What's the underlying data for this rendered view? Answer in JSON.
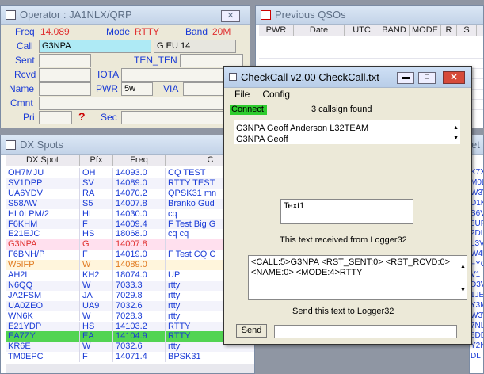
{
  "operator": {
    "title": "Operator : JA1NLX/QRP",
    "freq_label": "Freq",
    "freq_value": "14.089",
    "mode_label": "Mode",
    "mode_value": "RTTY",
    "band_label": "Band",
    "band_value": "20M",
    "call_label": "Call",
    "call_value": "G3NPA",
    "call_info": "G  EU  14",
    "sent_label": "Sent",
    "ten_label": "TEN_TEN",
    "rcvd_label": "Rcvd",
    "iota_label": "IOTA",
    "name_label": "Name",
    "pwr_label": "PWR",
    "pwr_value": "5w",
    "via_label": "VIA",
    "cmnt_label": "Cmnt",
    "pri_label": "Pri",
    "question": "?",
    "sec_label": "Sec"
  },
  "qsos": {
    "title": "Previous QSOs",
    "columns": [
      "PWR",
      "Date",
      "UTC",
      "BAND",
      "MODE",
      "R",
      "S"
    ]
  },
  "dx": {
    "title": "DX Spots",
    "columns": [
      "DX Spot",
      "Pfx",
      "Freq",
      "C"
    ],
    "rows": [
      {
        "call": "OH7MJU",
        "pfx": "OH",
        "freq": "14093.0",
        "comment": "CQ TEST"
      },
      {
        "call": "SV1DPP",
        "pfx": "SV",
        "freq": "14089.0",
        "comment": "RTTY TEST"
      },
      {
        "call": "UA6YDV",
        "pfx": "RA",
        "freq": "14070.2",
        "comment": "QPSK31 mn"
      },
      {
        "call": "S58AW",
        "pfx": "S5",
        "freq": "14007.8",
        "comment": "Branko Gud"
      },
      {
        "call": "HL0LPM/2",
        "pfx": "HL",
        "freq": "14030.0",
        "comment": "cq"
      },
      {
        "call": "F6KHM",
        "pfx": "F",
        "freq": "14009.4",
        "comment": "F Test Big G"
      },
      {
        "call": "E21EJC",
        "pfx": "HS",
        "freq": "18068.0",
        "comment": "cq cq"
      },
      {
        "call": "G3NPA",
        "pfx": "G",
        "freq": "14007.8",
        "comment": ""
      },
      {
        "call": "F6BNH/P",
        "pfx": "F",
        "freq": "14019.0",
        "comment": "F Test CQ C"
      },
      {
        "call": "W5IFP",
        "pfx": "W",
        "freq": "14089.0",
        "comment": ""
      },
      {
        "call": "AH2L",
        "pfx": "KH2",
        "freq": "18074.0",
        "comment": "UP"
      },
      {
        "call": "N6QQ",
        "pfx": "W",
        "freq": "7033.3",
        "comment": "rtty"
      },
      {
        "call": "JA2FSM",
        "pfx": "JA",
        "freq": "7029.8",
        "comment": "rtty"
      },
      {
        "call": "UA0ZEO",
        "pfx": "UA9",
        "freq": "7032.6",
        "comment": "rtty"
      },
      {
        "call": "WN6K",
        "pfx": "W",
        "freq": "7028.3",
        "comment": "rtty"
      },
      {
        "call": "E21YDP",
        "pfx": "HS",
        "freq": "14103.2",
        "comment": "RTTY"
      },
      {
        "call": "EA7ZY",
        "pfx": "EA",
        "freq": "14104.9",
        "comment": "RTTY"
      },
      {
        "call": "KR6E",
        "pfx": "W",
        "freq": "7032.6",
        "comment": "rtty"
      },
      {
        "call": "TM0EPC",
        "pfx": "F",
        "freq": "14071.4",
        "comment": "BPSK31"
      }
    ]
  },
  "right_edge": {
    "et": "et",
    "codes": [
      "K7X",
      "M0L",
      "W3V",
      "D1K",
      "S6V",
      "3UF",
      "2DL",
      "L3V",
      "W4L",
      "FYC",
      "V1",
      "D3V",
      "1JE",
      "Y3M",
      "W3V",
      "7NL",
      "6DD",
      "Y2N",
      "DL"
    ]
  },
  "checkcall": {
    "title": "CheckCall v2.00  CheckCall.txt",
    "menu_file": "File",
    "menu_config": "Config",
    "connect": "Connect",
    "found": "3 callsign found",
    "list_line1": "G3NPA  Geoff  Anderson   L32TEAM",
    "list_line2": "G3NPA  Geoff",
    "text1": "Text1",
    "received_label": "This text received from Logger32",
    "received_text": "<CALL:5>G3NPA <RST_SENT:0> <RST_RCVD:0> <NAME:0> <MODE:4>RTTY",
    "send_label": "Send this text to Logger32",
    "send_button": "Send",
    "send_value": ""
  },
  "colors": {
    "accent": "#1a3bd6",
    "highlight": "#e03030",
    "connect": "#2ecc2e"
  }
}
